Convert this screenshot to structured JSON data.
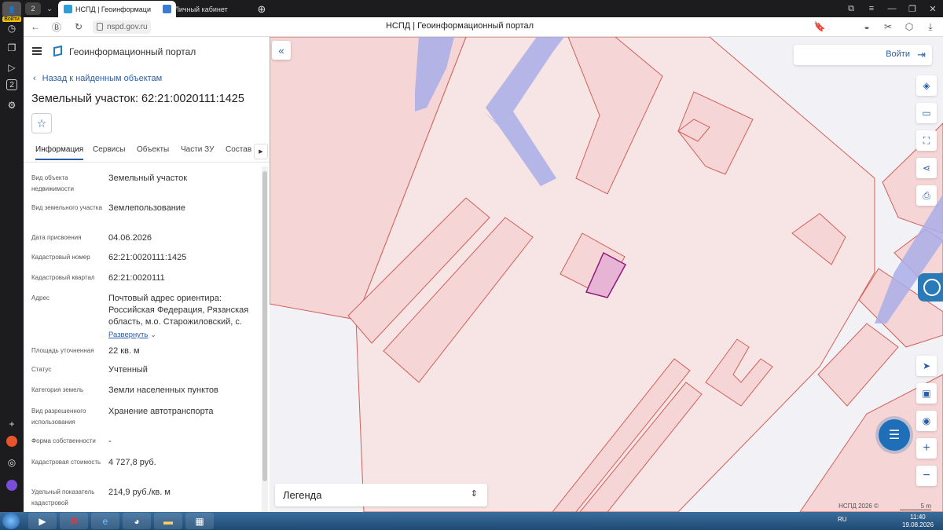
{
  "browser": {
    "leftbar": {
      "avatar_label": "Войти",
      "tab_counter": "2",
      "badge_counter": "2"
    },
    "tabs": [
      {
        "label": "НСПД | Геоинформаци",
        "active": true
      },
      {
        "label": "Личный кабинет",
        "active": false
      }
    ],
    "url": "nspd.gov.ru",
    "page_title": "НСПД | Геоинформационный портал"
  },
  "panel": {
    "app_name": "Геоинформационный портал",
    "back_link": "Назад к найденным объектам",
    "title": "Земельный участок: 62:21:0020111:1425",
    "tabs": [
      "Информация",
      "Сервисы",
      "Объекты",
      "Части ЗУ",
      "Состав"
    ],
    "properties": [
      {
        "label": "Вид объекта недвижимости",
        "value": "Земельный участок"
      },
      {
        "label": "Вид земельного участка",
        "value": "Землепользование"
      },
      {
        "label": "Дата присвоения",
        "value": "04.06.2026"
      },
      {
        "label": "Кадастровый номер",
        "value": "62:21:0020111:1425"
      },
      {
        "label": "Кадастровый квартал",
        "value": "62:21:0020111"
      },
      {
        "label": "Адрес",
        "value": "Почтовый адрес ориентира: Российская Федерация, Рязанская область, м.о. Старожиловский, с.",
        "action": "Развернуть"
      },
      {
        "label": "Площадь уточненная",
        "value": "22 кв. м"
      },
      {
        "label": "Статус",
        "value": "Учтенный"
      },
      {
        "label": "Категория земель",
        "value": "Земли населенных пунктов"
      },
      {
        "label": "Вид разрешенного использования",
        "value": "Хранение автотранспорта"
      },
      {
        "label": "Форма собственности",
        "value": "-"
      },
      {
        "label": "Кадастровая стоимость",
        "value": "4 727,8 руб."
      },
      {
        "label": "Удельный показатель кадастровой",
        "value": "214,9 руб./кв. м"
      }
    ]
  },
  "map": {
    "login_label": "Войти",
    "legend_label": "Легенда",
    "copyright": "НСПД 2026 ©",
    "scale_label": "5 m",
    "colors": {
      "parcel_fill": "#f5d5d5",
      "parcel_stroke": "#d0605a",
      "road": "#a9aee8",
      "selected_fill": "#e8b4d6",
      "selected_stroke": "#8c1b7a"
    }
  },
  "taskbar": {
    "lang": "RU",
    "time": "11:40",
    "date": "19.08.2026"
  }
}
